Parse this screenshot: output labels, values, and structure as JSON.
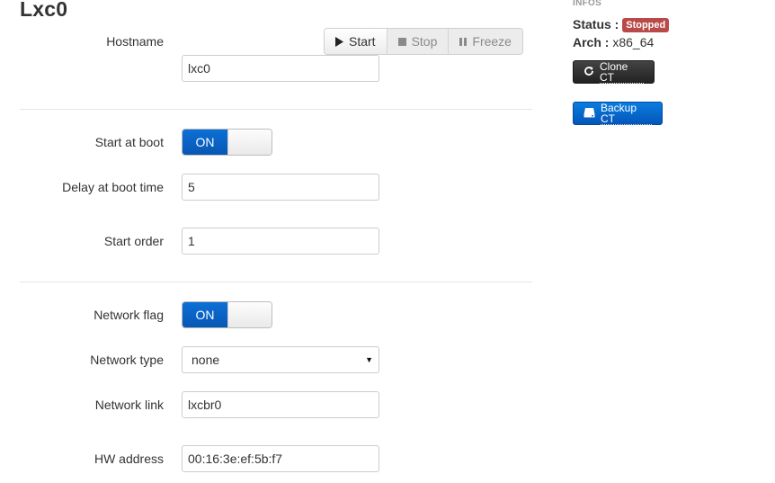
{
  "page": {
    "title": "Lxc0"
  },
  "actions": {
    "start_label": "Start",
    "stop_label": "Stop",
    "freeze_label": "Freeze"
  },
  "form": {
    "hostname": {
      "label": "Hostname",
      "value": "lxc0"
    },
    "start_at_boot": {
      "label": "Start at boot",
      "state": "ON"
    },
    "delay_at_boot": {
      "label": "Delay at boot time",
      "value": "5"
    },
    "start_order": {
      "label": "Start order",
      "value": "1"
    },
    "network_flag": {
      "label": "Network flag",
      "state": "ON"
    },
    "network_type": {
      "label": "Network type",
      "selected": "none"
    },
    "network_link": {
      "label": "Network link",
      "value": "lxcbr0"
    },
    "hw_address": {
      "label": "HW address",
      "value": "00:16:3e:ef:5b:f7"
    }
  },
  "infos": {
    "heading": "INFOS",
    "status_label": "Status :",
    "status_value": "Stopped",
    "arch_label": "Arch :",
    "arch_value": "x86_64",
    "clone_label": "Clone CT",
    "backup_label": "Backup CT"
  },
  "colors": {
    "toggle_on": "#0757b4",
    "badge_stopped": "#b94a48",
    "clone_button": "#222222",
    "backup_button": "#0456b8"
  }
}
